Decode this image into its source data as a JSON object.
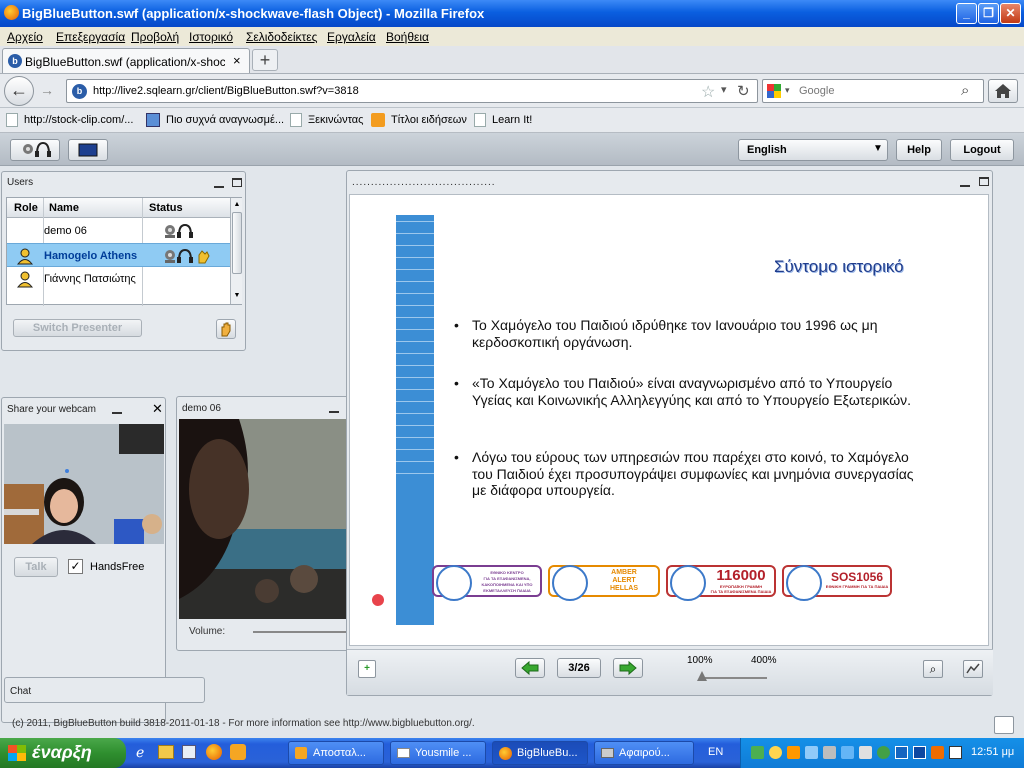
{
  "window": {
    "title": "BigBlueButton.swf (application/x-shockwave-flash Object) - Mozilla Firefox"
  },
  "menu": [
    "Αρχείο",
    "Επεξεργασία",
    "Προβολή",
    "Ιστορικό",
    "Σελιδοδείκτες",
    "Εργαλεία",
    "Βοήθεια"
  ],
  "tab": {
    "title": "BigBlueButton.swf (application/x-shockwave-...",
    "close": "×",
    "new_tab": "+"
  },
  "nav": {
    "url": "http://live2.sqlearn.gr/client/BigBlueButton.swf?v=3818",
    "search_placeholder": "Google"
  },
  "bookmarks": [
    "http://stock-clip.com/...",
    "Πιο συχνά αναγνωσμέ...",
    "Ξεκινώντας",
    "Τίτλοι ειδήσεων",
    "Learn It!"
  ],
  "app_toolbar": {
    "language": "English",
    "help": "Help",
    "logout": "Logout"
  },
  "users_panel": {
    "title": "Users",
    "columns": [
      "Role",
      "Name",
      "Status"
    ],
    "rows": [
      {
        "name": "demo 06"
      },
      {
        "name": "Hamogelo Athens"
      },
      {
        "name": "Γιάννης Πατσιώτης"
      }
    ],
    "switch_presenter": "Switch Presenter"
  },
  "webcam_panel": {
    "title": "Share your webcam",
    "talk": "Talk",
    "handsfree": "HandsFree"
  },
  "video_panel": {
    "title": "demo 06",
    "volume_label": "Volume:"
  },
  "chat_panel": {
    "title": "Chat"
  },
  "presentation": {
    "title": "......................................",
    "slide_title": "Σύντομο ιστορικό",
    "bullets": [
      "Το Χαμόγελο του Παιδιού ιδρύθηκε τον Ιανουάριο του 1996 ως μη κερδοσκοπική οργάνωση.",
      "«Το Χαμόγελο του Παιδιού» είναι αναγνωρισμένο από το Υπουργείο Υγείας και Κοινωνικής Αλληλεγγύης και από το Υπουργείο Εξωτερικών.",
      "Λόγω του εύρους των υπηρεσιών που παρέχει στο κοινό, το Χαμόγελο του Παιδιού έχει προσυπογράψει συμφωνίες και μνημόνια συνεργασίας με διάφορα υπουργεία."
    ],
    "badges": [
      {
        "line1": "ΕΘΝΙΚΟ ΚΕΝΤΡΟ",
        "line2": "ΓΙΑ ΤΑ ΕΞΑΦΑΝΙΣΜΕΝΑ, ΚΑΚΟΠΟΙΗΜΕΝΑ ΚΑΙ ΥΠΟ",
        "line3": "ΕΚΜΕΤΑΛΛΕΥΣΗ ΠΑΙΔΙΑ",
        "color": "#7a3d91"
      },
      {
        "line1": "AMBER",
        "line2": "ALERT",
        "line3": "HELLAS",
        "color": "#e68a00"
      },
      {
        "line1": "116000",
        "line2": "ΕΥΡΩΠΑΪΚΗ ΓΡΑΜΜΗ",
        "line3": "ΓΙΑ ΤΑ ΕΞΑΦΑΝΙΣΜΕΝΑ ΠΑΙΔΙΑ",
        "color": "#b3202a"
      },
      {
        "line1": "SOS1056",
        "line2": "ΕΘΝΙΚΗ ΓΡΑΜΜΗ ΓΙΑ ΤΑ ΠΑΙΔΙΑ",
        "line3": "",
        "color": "#b3202a"
      }
    ],
    "page_indicator": "3/26",
    "zoom_min": "100%",
    "zoom_max": "400%",
    "zoom_value": 0
  },
  "footer": "(c) 2011, BigBlueButton build 3818-2011-01-18 - For more information see http://www.bigbluebutton.org/.",
  "taskbar": {
    "start": "έναρξη",
    "tasks": [
      "Αποσταλ...",
      "Yousmile ...",
      "BigBlueBu...",
      "Αφαιρού..."
    ],
    "language": "EN",
    "clock": "12:51 μμ"
  }
}
